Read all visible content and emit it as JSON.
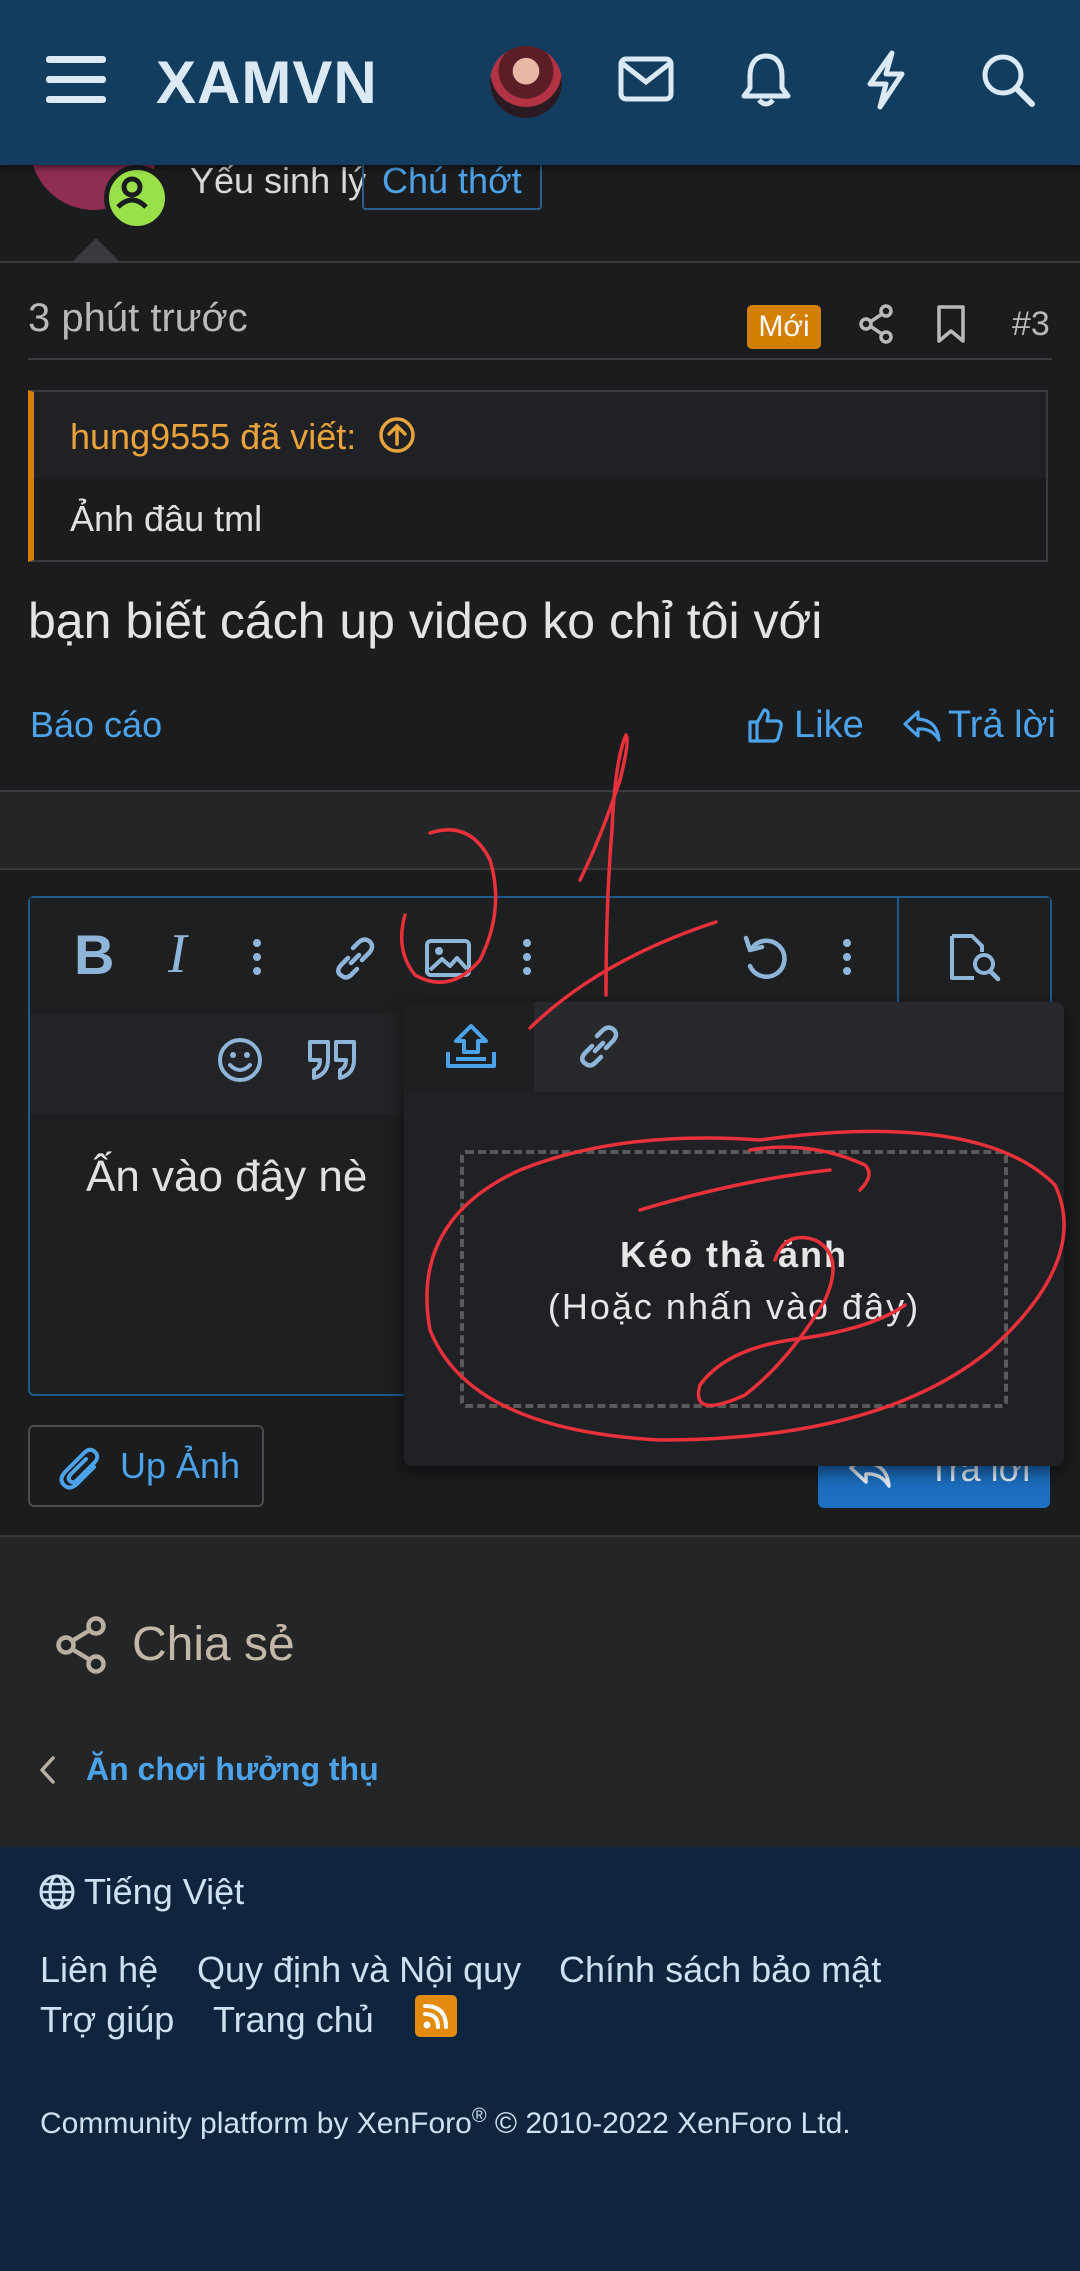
{
  "header": {
    "logo": "XAMVN",
    "icons": [
      "menu-icon",
      "avatar",
      "mail-icon",
      "bell-icon",
      "lightning-icon",
      "search-icon"
    ]
  },
  "user": {
    "role": "Yếu sinh lý",
    "badge": "Chú thớt"
  },
  "post": {
    "time": "3 phút trước",
    "new_badge": "Mới",
    "number": "#3",
    "quote_author": "hung9555 đã viết:",
    "quote_text": "Ảnh đâu tml",
    "message": "bạn biết cách up video ko chỉ tôi với",
    "report": "Báo cáo",
    "like": "Like",
    "reply": "Trả lời"
  },
  "editor": {
    "content": "Ấn vào đây nè",
    "popup": {
      "title": "Kéo thả ảnh",
      "subtitle": "(Hoặc nhấn vào đây)"
    },
    "upload_button": "Up Ảnh",
    "submit_button": "Trả lời"
  },
  "share": {
    "label": "Chia sẻ",
    "breadcrumb": "Ăn chơi hưởng thụ"
  },
  "footer": {
    "language": "Tiếng Việt",
    "links": [
      "Liên hệ",
      "Quy định và Nội quy",
      "Chính sách bảo mật",
      "Trợ giúp",
      "Trang chủ"
    ],
    "copyright_pre": "Community platform by XenForo",
    "copyright_reg": "®",
    "copyright_post": " © 2010-2022 XenForo Ltd."
  },
  "colors": {
    "header": "#123d5f",
    "accent": "#4da3ea",
    "new_badge": "#d37f00",
    "annotation": "#e8313a",
    "footer": "#0f253d"
  }
}
